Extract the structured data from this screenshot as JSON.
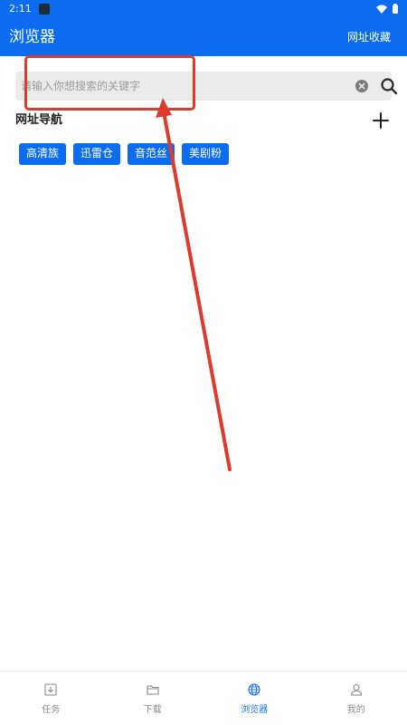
{
  "status": {
    "time": "2:11"
  },
  "header": {
    "title": "浏览器",
    "action_label": "网址收藏"
  },
  "search": {
    "placeholder": "请输入你想搜索的关键字",
    "value": ""
  },
  "nav_section": {
    "title": "网址导航",
    "sites": [
      "高清族",
      "迅雷仓",
      "音范丝",
      "美剧粉"
    ]
  },
  "bottom_nav": {
    "items": [
      {
        "label": "任务",
        "icon": "task-icon"
      },
      {
        "label": "下载",
        "icon": "folder-icon"
      },
      {
        "label": "浏览器",
        "icon": "globe-icon"
      },
      {
        "label": "我的",
        "icon": "person-icon"
      }
    ],
    "active": "浏览器"
  },
  "colors": {
    "accent": "#0b6cf0",
    "annotation": "#e03a2e",
    "active_nav": "#1a73e8",
    "inactive_nav": "#8a8a8a"
  }
}
